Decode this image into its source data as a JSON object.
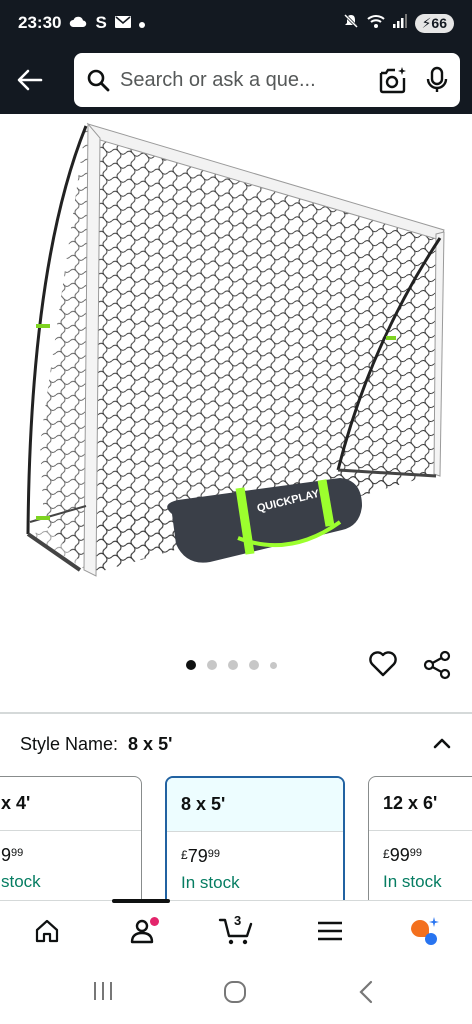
{
  "status_bar": {
    "time": "23:30",
    "left_icons": [
      "cloud-icon",
      "s-icon",
      "mail-icon",
      "dot-icon"
    ],
    "s_label": "S",
    "right_icons": [
      "mute-icon",
      "wifi-icon",
      "signal-icon"
    ],
    "battery": "66"
  },
  "search": {
    "placeholder": "Search or ask a que..."
  },
  "carousel": {
    "total_dots": 5,
    "active_index": 0
  },
  "style_selector": {
    "label": "Style Name:",
    "selected_value": "8 x 5'",
    "options": [
      {
        "title": "x 4'",
        "currency": "",
        "price_main": "9",
        "price_fraction": "99",
        "stock": "stock"
      },
      {
        "title": "8 x 5'",
        "currency": "£",
        "price_main": "79",
        "price_fraction": "99",
        "stock": "In stock"
      },
      {
        "title": "12 x 6'",
        "currency": "£",
        "price_main": "99",
        "price_fraction": "99",
        "stock": "In stock"
      }
    ]
  },
  "bottom_nav": {
    "items": [
      "home-icon",
      "account-icon",
      "cart-icon",
      "menu-icon",
      "rufus-icon"
    ],
    "cart_count": "3"
  },
  "colors": {
    "header_bg": "#131921",
    "selected_border": "#2162a1",
    "stock_green": "#067d62",
    "rufus_orange": "#f3701e",
    "rufus_blue": "#2874f0",
    "notification_pink": "#e3256b"
  }
}
